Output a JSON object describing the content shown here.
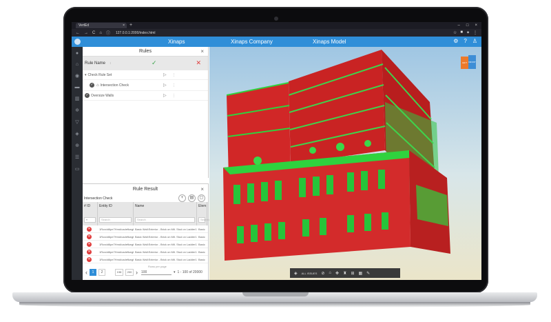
{
  "browser": {
    "tab_title": "VertEd",
    "url": "127.0.0.1:2000/index.html"
  },
  "header": {
    "brand": "Xinaps",
    "company": "Xinaps Company",
    "model": "Xinaps Model"
  },
  "rules_panel": {
    "title": "Rules",
    "column_label": "Rule Name",
    "rules": [
      {
        "label": "Check Rule Set"
      },
      {
        "label": "Intersection Check"
      },
      {
        "label": "Oversize Walls"
      }
    ]
  },
  "result_panel": {
    "title": "Rule Result",
    "subtitle": "Intersection Check",
    "columns": [
      "# ID",
      "Entity ID",
      "Name",
      "Elem"
    ],
    "filter_placeholder": "Search",
    "rows": [
      {
        "entity": "1Roxdd6pe7Hmd/cadefkwgt",
        "name": "Basic Wall:Exterior - Brick on Mtl. Stud on Ladder1:10550",
        "elem": "Basic"
      },
      {
        "entity": "1Roxdd6pe7Hmd/cadefkwgt",
        "name": "Basic Wall:Exterior - Brick on Mtl. Stud on Ladder1:10550",
        "elem": "Basic"
      },
      {
        "entity": "1Roxdd6pe7Hmd/cadefkwgt",
        "name": "Basic Wall:Exterior - Brick on Mtl. Stud on Ladder1:10550",
        "elem": "Basic"
      },
      {
        "entity": "1Roxdd6pe7Hmd/cadefkwgt",
        "name": "Basic Wall:Exterior - Brick on Mtl. Stud on Ladder1:10550",
        "elem": "Basic"
      },
      {
        "entity": "1Roxdd6pe7Hmd/cadefkwgt",
        "name": "Basic Wall:Exterior - Brick on Mtl. Stud on Ladder1:10550",
        "elem": "Basic"
      }
    ],
    "pager": {
      "pages": [
        "1",
        "2"
      ],
      "extra": [
        "198",
        "200"
      ],
      "per_page_label": "Rows per page",
      "per_page": "100",
      "range": "1 - 100 of 20000"
    }
  },
  "viewer": {
    "toolbar_label": "ALL ISSUES",
    "nav_cube_left": "LEFT",
    "nav_cube_front": "FRONT"
  },
  "colors": {
    "accent": "#2f8ed8",
    "fail": "#e03b3b",
    "pass": "#3aa44b",
    "building_red": "#d32b2b",
    "building_green": "#27c43a"
  }
}
